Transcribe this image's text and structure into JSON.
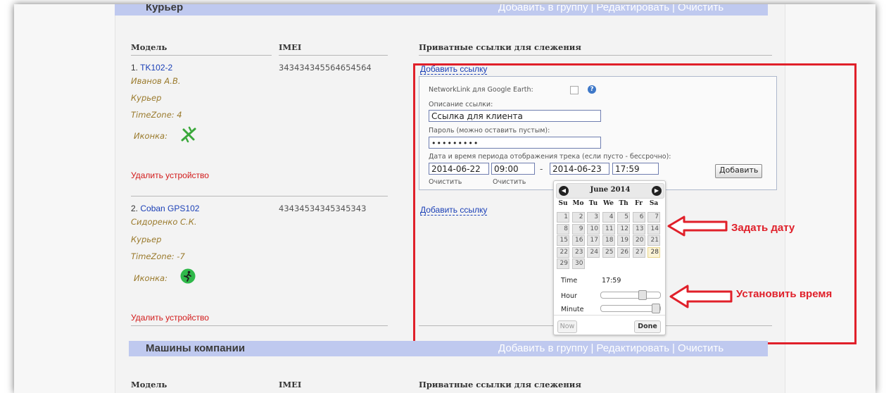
{
  "group1": {
    "title": "Курьер",
    "actions": [
      "Добавить в группу",
      "Редактировать",
      "Очистить"
    ],
    "columns": {
      "model": "Модель",
      "imei": "IMEI",
      "links": "Приватные ссылки для слежения"
    },
    "devices": [
      {
        "num": "1.",
        "name": "TK102-2",
        "imei": "343434345564654564",
        "owner": "Иванов А.В.",
        "group": "Курьер",
        "timezone": "TimeZone: 4",
        "icon_label": "Иконка:",
        "icon": "airplane-icon",
        "delete": "Удалить устройство",
        "add_link": "Добавить ссылку"
      },
      {
        "num": "2.",
        "name": "Coban GPS102",
        "imei": "43434534345345343",
        "owner": "Сидоренко С.К.",
        "group": "Курьер",
        "timezone": "TimeZone: -7",
        "icon_label": "Иконка:",
        "icon": "runner-icon",
        "delete": "Удалить устройство",
        "add_link": "Добавить ссылку"
      }
    ]
  },
  "form": {
    "networklink_label": "NetworkLink для Google Earth:",
    "description_label": "Описание ссылки:",
    "description_value": "Ссылка для клиента",
    "password_label": "Пароль (можно оставить пустым):",
    "password_value": "•••••••••",
    "period_label": "Дата и время периода отображения трека (если пусто - бессрочно):",
    "start_date": "2014-06-22",
    "start_time": "09:00",
    "dash": "-",
    "end_date": "2014-06-23",
    "end_time": "17:59",
    "clear_label": "Очистить",
    "add_button": "Добавить"
  },
  "calendar": {
    "month_title": "June 2014",
    "dow": [
      "Su",
      "Mo",
      "Tu",
      "We",
      "Th",
      "Fr",
      "Sa"
    ],
    "days": [
      "1",
      "2",
      "3",
      "4",
      "5",
      "6",
      "7",
      "8",
      "9",
      "10",
      "11",
      "12",
      "13",
      "14",
      "15",
      "16",
      "17",
      "18",
      "19",
      "20",
      "21",
      "22",
      "23",
      "24",
      "25",
      "26",
      "27",
      "28",
      "29",
      "30"
    ],
    "today": "28",
    "time_label": "Time",
    "time_value": "17:59",
    "hour_label": "Hour",
    "minute_label": "Minute",
    "hour_level": 0.74,
    "minute_level": 1.0,
    "now_button": "Now",
    "done_button": "Done"
  },
  "annotations": {
    "set_date": "Задать дату",
    "set_time": "Установить время",
    "color": "#e0202a"
  },
  "group2": {
    "title": "Машины компании",
    "actions": [
      "Добавить в группу",
      "Редактировать",
      "Очистить"
    ],
    "columns": {
      "model": "Модель",
      "imei": "IMEI",
      "links": "Приватные ссылки для слежения"
    }
  }
}
